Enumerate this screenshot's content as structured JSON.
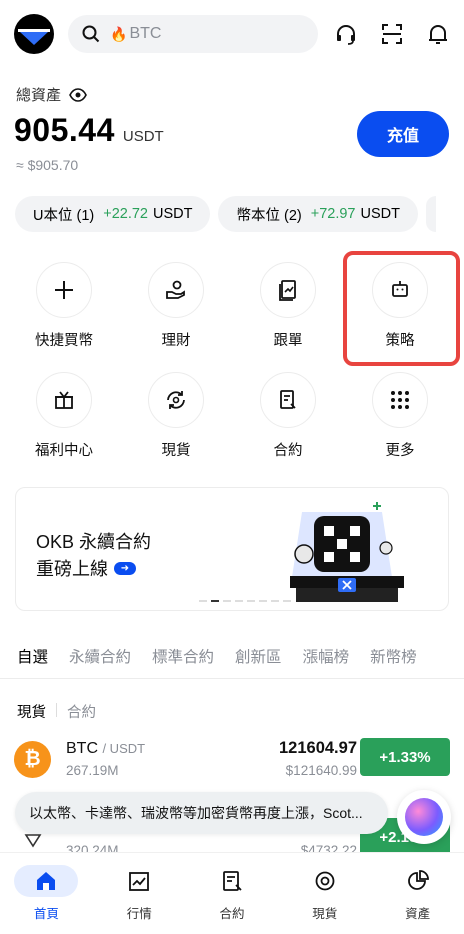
{
  "header": {
    "search_placeholder": "BTC"
  },
  "assets": {
    "label": "總資產",
    "value": "905.44",
    "currency": "USDT",
    "approx": "≈ $905.70",
    "deposit_label": "充值"
  },
  "pills": [
    {
      "label": "U本位 (1)",
      "change": "+22.72",
      "unit": "USDT"
    },
    {
      "label": "幣本位 (2)",
      "change": "+72.97",
      "unit": "USDT"
    }
  ],
  "shortcuts": [
    {
      "label": "快捷買幣",
      "icon": "plus-icon"
    },
    {
      "label": "理財",
      "icon": "hand-coin-icon"
    },
    {
      "label": "跟單",
      "icon": "copy-trade-icon"
    },
    {
      "label": "策略",
      "icon": "robot-icon"
    },
    {
      "label": "福利中心",
      "icon": "gift-icon"
    },
    {
      "label": "現貨",
      "icon": "spot-exchange-icon"
    },
    {
      "label": "合約",
      "icon": "contract-doc-icon"
    },
    {
      "label": "更多",
      "icon": "grid-dots-icon"
    }
  ],
  "banner": {
    "line1": "OKB 永續合約",
    "line2": "重磅上線"
  },
  "market_tabs": [
    "自選",
    "永續合約",
    "標準合約",
    "創新區",
    "漲幅榜",
    "新幣榜"
  ],
  "sub_tabs": [
    "現貨",
    "合約"
  ],
  "rows": [
    {
      "base": "BTC",
      "quote": "/ USDT",
      "volume": "267.19M",
      "price": "121604.97",
      "fiat": "$121640.99",
      "change": "+1.33%"
    },
    {
      "base": "",
      "quote": "",
      "volume": "320.24M",
      "price": "",
      "fiat": "$4732.22",
      "change": "+2.18%"
    }
  ],
  "toast": "以太幣、卡達幣、瑞波幣等加密貨幣再度上漲，Scot...",
  "nav": [
    {
      "label": "首頁",
      "icon": "home-icon"
    },
    {
      "label": "行情",
      "icon": "chart-icon"
    },
    {
      "label": "合約",
      "icon": "contract-icon"
    },
    {
      "label": "現貨",
      "icon": "spot-icon"
    },
    {
      "label": "資產",
      "icon": "pie-icon"
    }
  ],
  "colors": {
    "accent": "#0a4df0",
    "positive": "#2aa05a",
    "highlight": "#e8443f"
  }
}
